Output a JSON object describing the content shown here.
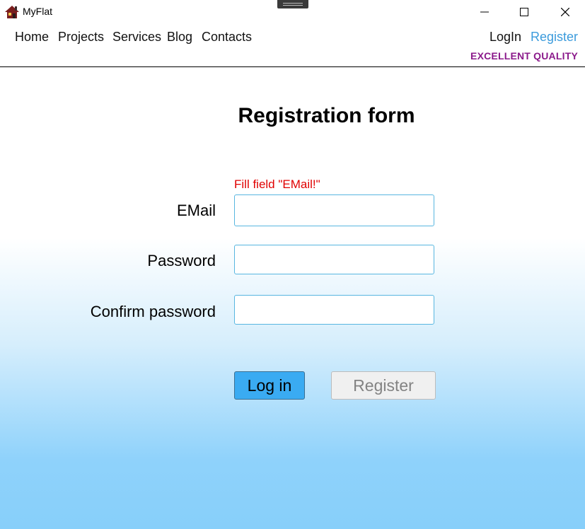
{
  "window": {
    "title": "MyFlat",
    "icon": "house-icon",
    "controls": {
      "minimize": "minimize-icon",
      "maximize": "maximize-icon",
      "close": "close-icon"
    }
  },
  "nav": {
    "items": [
      "Home",
      "Projects",
      "Services",
      "Blog",
      "Contacts"
    ],
    "login_label": "LogIn",
    "register_label": "Register",
    "slogan": "EXCELLENT QUALITY"
  },
  "form": {
    "title": "Registration form",
    "error": "Fill field \"EMail!\"",
    "email_label": "EMail",
    "password_label": "Password",
    "confirm_label": "Confirm password",
    "email_value": "",
    "password_value": "",
    "confirm_value": "",
    "login_button": "Log in",
    "register_button": "Register"
  },
  "colors": {
    "accent": "#3b9bdc",
    "slogan": "#8b1a8b",
    "error": "#e00000",
    "primary_button": "#3aabf2",
    "gradient_bottom": "#87cffa"
  }
}
